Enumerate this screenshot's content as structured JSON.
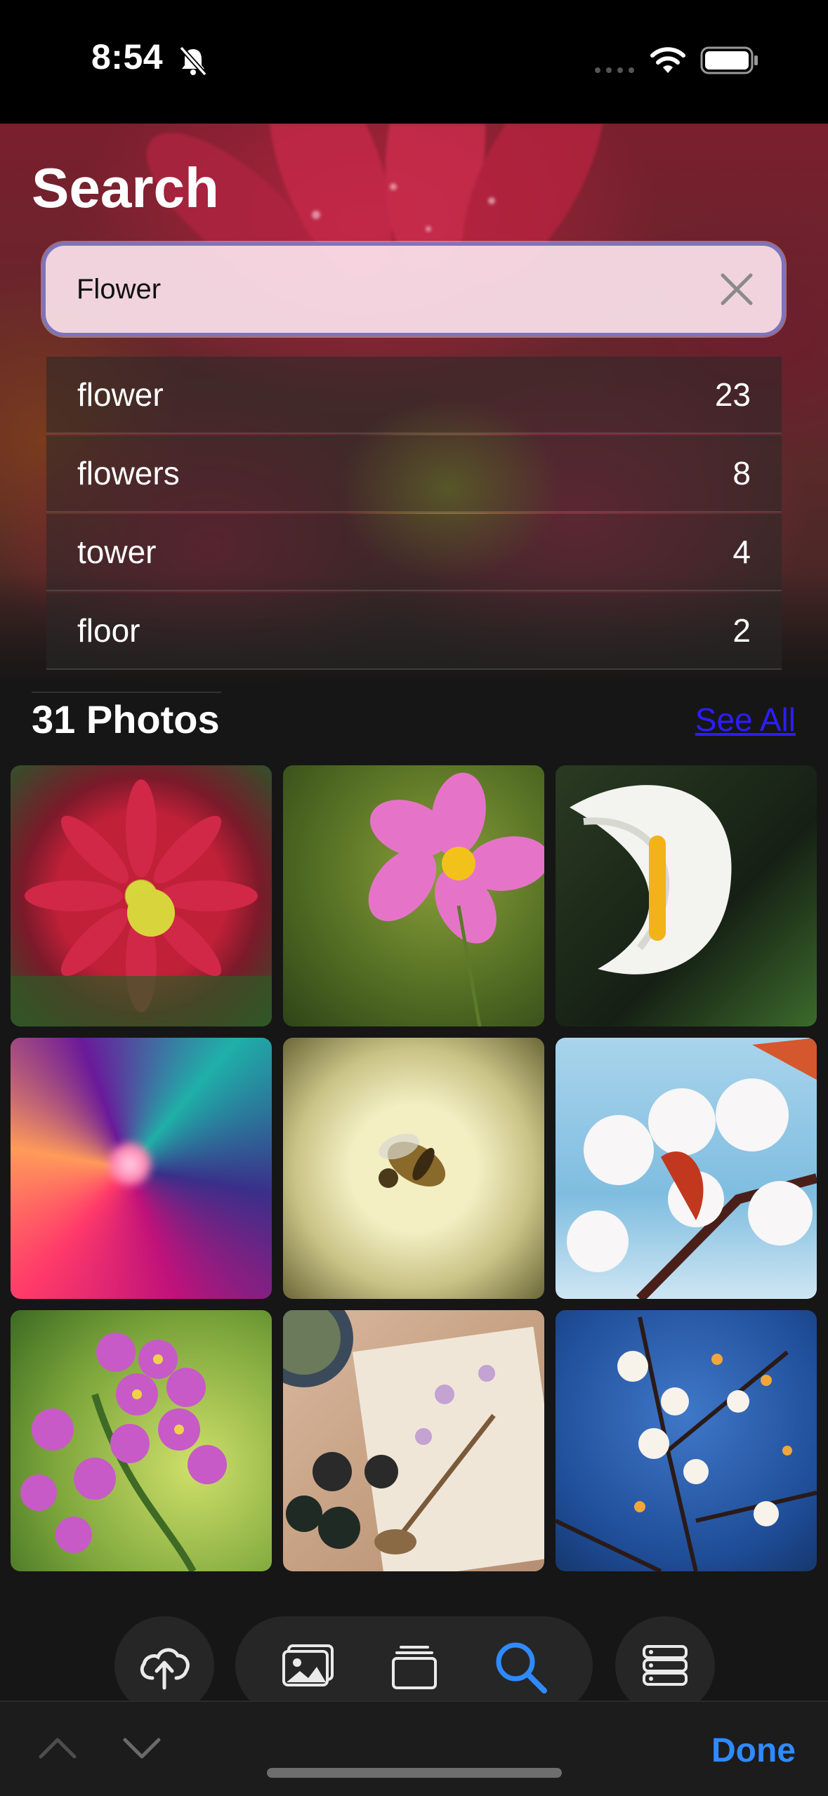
{
  "status": {
    "time": "8:54"
  },
  "header": {
    "title": "Search"
  },
  "search": {
    "value": "Flower",
    "clear_icon": "close-icon"
  },
  "suggestions": [
    {
      "label": "flower",
      "count": "23"
    },
    {
      "label": "flowers",
      "count": "8"
    },
    {
      "label": "tower",
      "count": "4"
    },
    {
      "label": "floor",
      "count": "2"
    }
  ],
  "results": {
    "title": "31 Photos",
    "see_all": "See All",
    "photos": [
      "red-dahlia-photo",
      "pink-cosmos-photo",
      "white-calla-lily-photo",
      "abstract-swirl-photo",
      "bee-on-flower-photo",
      "white-blossom-photo",
      "purple-bergenia-photo",
      "pressed-flowers-spoon-photo",
      "plum-blossom-photo"
    ]
  },
  "tabbar": {
    "icons": [
      "cloud-upload-icon",
      "photos-icon",
      "albums-icon",
      "search-icon",
      "list-icon"
    ],
    "active": "search-icon",
    "accent": "#2e8bff"
  },
  "keyboard_accessory": {
    "done": "Done"
  }
}
